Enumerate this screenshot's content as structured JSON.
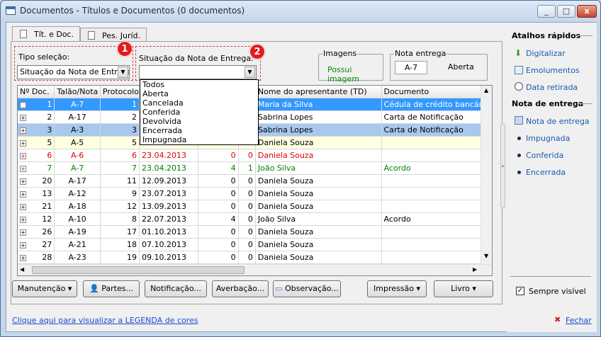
{
  "window": {
    "title": "Documentos - Títulos e Documentos (0 documentos)",
    "minimize": "_",
    "maximize": "□",
    "close": "x"
  },
  "tabs": [
    {
      "label": "Tít. e Doc."
    },
    {
      "label": "Pes. Juríd."
    }
  ],
  "filter": {
    "tipo_label": "Tipo seleção:",
    "tipo_value": "Situação da Nota de Entrega",
    "situacao_label": "Situação da Nota de Entrega:",
    "situacao_value": "",
    "badge1": "1",
    "badge2": "2",
    "arrow": "▼"
  },
  "dropdown_options": [
    "Todos",
    "Aberta",
    "Cancelada",
    "Conferida",
    "Devolvida",
    "Encerrada",
    "Impugnada"
  ],
  "imagens": {
    "title": "Imagens",
    "value": "Possui imagem"
  },
  "nota": {
    "title": "Nota entrega",
    "code": "A-7",
    "status": "Aberta"
  },
  "columns": [
    "Nº Doc.",
    "Talão/Nota",
    "Protocolo",
    "",
    "",
    "",
    "Nome do apresentante (TD)",
    "Documento"
  ],
  "rows": [
    {
      "n": "1",
      "t": "A-7",
      "p": "1",
      "d": "",
      "a": "",
      "b": "",
      "nome": "Maria da Silva",
      "doc": "Cédula de crédito bancário",
      "s": "sel"
    },
    {
      "n": "2",
      "t": "A-17",
      "p": "2",
      "d": "",
      "a": "",
      "b": "",
      "nome": "Sabrina Lopes",
      "doc": "Carta de Notificação",
      "s": ""
    },
    {
      "n": "3",
      "t": "A-3",
      "p": "3",
      "d": "",
      "a": "",
      "b": "",
      "nome": "Sabrina Lopes",
      "doc": "Carta de Notificação",
      "s": "sel2"
    },
    {
      "n": "5",
      "t": "A-5",
      "p": "5",
      "d": "",
      "a": "",
      "b": "",
      "nome": "Daniela Souza",
      "doc": "",
      "s": "yellow"
    },
    {
      "n": "6",
      "t": "A-6",
      "p": "6",
      "d": "23.04.2013",
      "a": "0",
      "b": "0",
      "nome": "Daniela Souza",
      "doc": "",
      "s": "red"
    },
    {
      "n": "7",
      "t": "A-7",
      "p": "7",
      "d": "23.04.2013",
      "a": "4",
      "b": "1",
      "nome": "João Silva",
      "doc": "Acordo",
      "s": "green"
    },
    {
      "n": "20",
      "t": "A-17",
      "p": "11",
      "d": "12.09.2013",
      "a": "0",
      "b": "0",
      "nome": "Daniela Souza",
      "doc": "",
      "s": ""
    },
    {
      "n": "13",
      "t": "A-12",
      "p": "9",
      "d": "23.07.2013",
      "a": "0",
      "b": "0",
      "nome": "Daniela Souza",
      "doc": "",
      "s": ""
    },
    {
      "n": "21",
      "t": "A-18",
      "p": "12",
      "d": "13.09.2013",
      "a": "0",
      "b": "0",
      "nome": "Daniela Souza",
      "doc": "",
      "s": ""
    },
    {
      "n": "12",
      "t": "A-10",
      "p": "8",
      "d": "22.07.2013",
      "a": "4",
      "b": "0",
      "nome": "João Silva",
      "doc": "Acordo",
      "s": ""
    },
    {
      "n": "26",
      "t": "A-19",
      "p": "17",
      "d": "01.10.2013",
      "a": "0",
      "b": "0",
      "nome": "Daniela Souza",
      "doc": "",
      "s": ""
    },
    {
      "n": "27",
      "t": "A-21",
      "p": "18",
      "d": "07.10.2013",
      "a": "0",
      "b": "0",
      "nome": "Daniela Souza",
      "doc": "",
      "s": ""
    },
    {
      "n": "28",
      "t": "A-23",
      "p": "19",
      "d": "09.10.2013",
      "a": "0",
      "b": "0",
      "nome": "Daniela Souza",
      "doc": "",
      "s": ""
    }
  ],
  "buttons": {
    "manutencao": "Manutenção",
    "partes": "Partes...",
    "notificacao": "Notificação...",
    "averbacao": "Averbação...",
    "observacao": "Observação...",
    "impressao": "Impressão",
    "livro": "Livro"
  },
  "side": {
    "atalhos": "Atalhos rápidos",
    "digitalizar": "Digitalizar",
    "emolumentos": "Emolumentos",
    "retirada": "Data retirada",
    "nota_head": "Nota de entrega",
    "nota_link": "Nota de entrega",
    "impugnada": "Impugnada",
    "conferida": "Conferida",
    "encerrada": "Encerrada",
    "sempre": "Sempre visível",
    "fechar": "Fechar",
    "check": "✓"
  },
  "footer": "Clique aqui para visualizar a LEGENDA de cores"
}
